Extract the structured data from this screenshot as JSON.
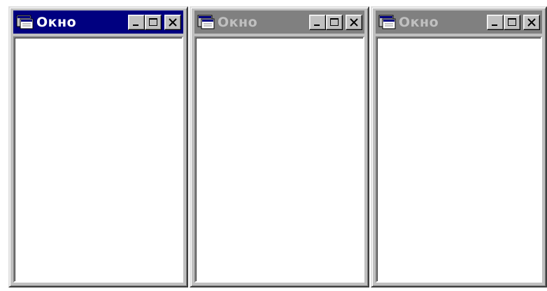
{
  "windows": [
    {
      "title": "Окно",
      "active": true
    },
    {
      "title": "Окно",
      "active": false
    },
    {
      "title": "Окно",
      "active": false
    }
  ],
  "icons": {
    "system": "window-system-icon",
    "minimize": "minimize-icon",
    "maximize": "maximize-icon",
    "close": "close-icon"
  },
  "colors": {
    "active_title": "#000080",
    "inactive_title": "#808080",
    "face": "#c0c0c0",
    "client": "#ffffff"
  }
}
